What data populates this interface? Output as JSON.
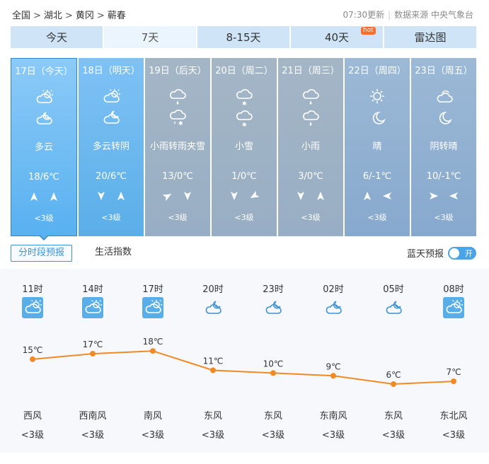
{
  "breadcrumb": {
    "items": [
      "全国",
      "湖北",
      "黄冈",
      "蕲春"
    ],
    "sep": ">"
  },
  "update": {
    "time": "07:30更新",
    "source": "数据来源 中央气象台"
  },
  "tabs": [
    {
      "label": "今天"
    },
    {
      "label": "7天",
      "active": true
    },
    {
      "label": "8-15天"
    },
    {
      "label": "40天",
      "badge": "hot"
    },
    {
      "label": "雷达图"
    }
  ],
  "days": [
    {
      "date": "17日（今天）",
      "icon1": "partly-cloudy-day",
      "icon2": "partly-cloudy-night",
      "weather": "多云",
      "temp": "18/6℃",
      "wind1": "up",
      "wind2": "up",
      "level": "<3级"
    },
    {
      "date": "18日（明天）",
      "icon1": "partly-cloudy-day",
      "icon2": "cloudy-night",
      "weather": "多云转阴",
      "temp": "20/6℃",
      "wind1": "down",
      "wind2": "up",
      "level": "<3级"
    },
    {
      "date": "19日（后天）",
      "icon1": "rain",
      "icon2": "sleet",
      "weather": "小雨转雨夹雪",
      "temp": "13/0℃",
      "wind1": "up-right",
      "wind2": "down",
      "level": "<3级"
    },
    {
      "date": "20日（周二）",
      "icon1": "snow",
      "icon2": "snow",
      "weather": "小雪",
      "temp": "1/0℃",
      "wind1": "down",
      "wind2": "down-left",
      "level": "<3级"
    },
    {
      "date": "21日（周三）",
      "icon1": "rain",
      "icon2": "rain",
      "weather": "小雨",
      "temp": "3/0℃",
      "wind1": "down",
      "wind2": "up",
      "level": "<3级"
    },
    {
      "date": "22日（周四）",
      "icon1": "sun",
      "icon2": "moon",
      "weather": "晴",
      "temp": "6/-1℃",
      "wind1": "up",
      "wind2": "left",
      "level": "<3级"
    },
    {
      "date": "23日（周五）",
      "icon1": "cloudy",
      "icon2": "moon",
      "weather": "阴转晴",
      "temp": "10/-1℃",
      "wind1": "right",
      "wind2": "left",
      "level": "<3级"
    }
  ],
  "subtabs": [
    {
      "label": "分时段预报",
      "active": true
    },
    {
      "label": "生活指数"
    }
  ],
  "bluesky": {
    "label": "蓝天预报",
    "toggle": "开"
  },
  "hourly": [
    {
      "time": "11时",
      "icon": "partly-cloudy-day-box",
      "temp": 15,
      "temp_label": "15℃",
      "wind": "西风",
      "level": "<3级"
    },
    {
      "time": "14时",
      "icon": "partly-cloudy-day-box",
      "temp": 17,
      "temp_label": "17℃",
      "wind": "西南风",
      "level": "<3级"
    },
    {
      "time": "17时",
      "icon": "partly-cloudy-day-box",
      "temp": 18,
      "temp_label": "18℃",
      "wind": "南风",
      "level": "<3级"
    },
    {
      "time": "20时",
      "icon": "cloudy-night",
      "temp": 11,
      "temp_label": "11℃",
      "wind": "东风",
      "level": "<3级"
    },
    {
      "time": "23时",
      "icon": "cloudy-night",
      "temp": 10,
      "temp_label": "10℃",
      "wind": "东风",
      "level": "<3级"
    },
    {
      "time": "02时",
      "icon": "cloudy-night",
      "temp": 9,
      "temp_label": "9℃",
      "wind": "东南风",
      "level": "<3级"
    },
    {
      "time": "05时",
      "icon": "cloudy-night",
      "temp": 6,
      "temp_label": "6℃",
      "wind": "东风",
      "level": "<3级"
    },
    {
      "time": "08时",
      "icon": "partly-cloudy-day-box",
      "temp": 7,
      "temp_label": "7℃",
      "wind": "东北风",
      "level": "<3级"
    }
  ],
  "colors": {
    "accent": "#3d93d8",
    "line": "#f08a26",
    "tab": "#cfe5f7"
  }
}
